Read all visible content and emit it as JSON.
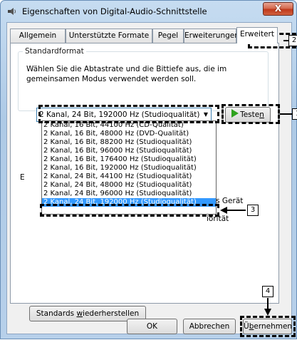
{
  "window": {
    "title": "Eigenschaften von Digital-Audio-Schnittstelle",
    "close_label": "X"
  },
  "tabs": [
    "Allgemein",
    "Unterstützte Formate",
    "Pegel",
    "Erweiterungen",
    "Erweitert"
  ],
  "group": {
    "title": "Standardformat",
    "description": "Wählen Sie die Abtastrate und die Bittiefe aus, die im gemeinsamen Modus verwendet werden soll."
  },
  "format_select": {
    "selected": "2 Kanal, 24 Bit, 192000 Hz (Studioqualität)"
  },
  "test_button": {
    "label_prefix": "Teste",
    "label_underlined": "n"
  },
  "dropdown_options": [
    "2 Kanal, 16 Bit, 44100 Hz (CD-Qualität)",
    "2 Kanal, 16 Bit, 48000 Hz (DVD-Qualität)",
    "2 Kanal, 16 Bit, 88200 Hz (Studioqualität)",
    "2 Kanal, 16 Bit, 96000 Hz (Studioqualität)",
    "2 Kanal, 16 Bit, 176400 Hz (Studioqualität)",
    "2 Kanal, 16 Bit, 192000 Hz (Studioqualität)",
    "2 Kanal, 24 Bit, 44100 Hz (Studioqualität)",
    "2 Kanal, 24 Bit, 48000 Hz (Studioqualität)",
    "2 Kanal, 24 Bit, 96000 Hz (Studioqualität)",
    "2 Kanal, 24 Bit, 192000 Hz (Studioqualität)"
  ],
  "partially_hidden": {
    "group_letter": "E",
    "text1": "das Gerät",
    "text2": "iorität"
  },
  "reset_button": {
    "prefix": "Standards ",
    "underlined": "w",
    "suffix": "iederherstellen"
  },
  "footer": {
    "ok": "OK",
    "cancel": "Abbrechen",
    "apply_prefix": "Ü",
    "apply_underlined": "b",
    "apply_suffix": "ernehmen"
  },
  "callouts": {
    "tab": "2",
    "test": "1",
    "item": "3",
    "apply": "4"
  },
  "colors": {
    "selection": "#3399ff",
    "test_play": "#2fa31f",
    "close": "#c0391b"
  }
}
